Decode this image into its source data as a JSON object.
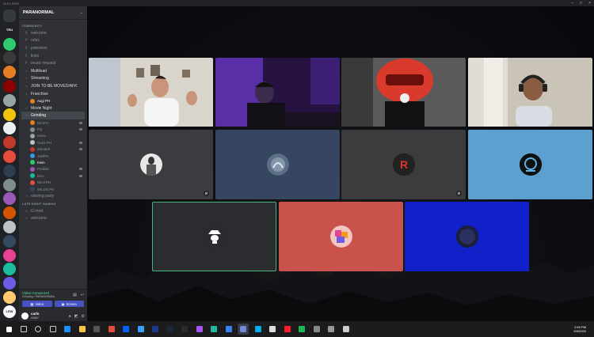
{
  "window": {
    "title": "DISCORD"
  },
  "server": {
    "name": "PARANORMAL"
  },
  "guilds": [
    {
      "label": "",
      "color": "#36393f"
    },
    {
      "label": "TRU",
      "color": "#202225"
    },
    {
      "label": "",
      "color": "#2ecc71"
    },
    {
      "label": "",
      "color": "#3a3a3a"
    },
    {
      "label": "",
      "color": "#e67e22"
    },
    {
      "label": "",
      "color": "#8b0000"
    },
    {
      "label": "",
      "color": "#95a5a6"
    },
    {
      "label": "",
      "color": "#f1c40f"
    },
    {
      "label": "",
      "color": "#ecf0f1"
    },
    {
      "label": "",
      "color": "#c0392b"
    },
    {
      "label": "",
      "color": "#e74c3c"
    },
    {
      "label": "",
      "color": "#2c3e50"
    },
    {
      "label": "",
      "color": "#7f8c8d"
    },
    {
      "label": "",
      "color": "#9b59b6"
    },
    {
      "label": "",
      "color": "#d35400"
    },
    {
      "label": "",
      "color": "#bdc3c7"
    },
    {
      "label": "",
      "color": "#34495e"
    },
    {
      "label": "",
      "color": "#e84393"
    },
    {
      "label": "",
      "color": "#1abc9c"
    },
    {
      "label": "",
      "color": "#6c5ce7"
    },
    {
      "label": "",
      "color": "#fdcb6e"
    },
    {
      "label": "LEW",
      "color": "#f5f6fa"
    }
  ],
  "sidebar": {
    "categories": [
      "COMMUNITY",
      "LATE NIGHT GAMING"
    ],
    "text_channels": [
      "welcome",
      "rules",
      "pokemon",
      "links",
      "music-request"
    ],
    "voice_channels": [
      "Multiload",
      "Streaming",
      "JOIN TO BE MOVED/AFK",
      "Franchise"
    ],
    "franchise_user": "Augi PH",
    "more_channels": [
      "Movie Night"
    ],
    "active_channel": "Grinding",
    "grinding_users": [
      "DevPH",
      "PQ",
      "Ivana",
      "Gumi PH",
      "Soloded",
      "JaelPH",
      "Kwin",
      "Freddie",
      "Ezio",
      "Nicol PH",
      "WILDS PH"
    ],
    "after_channels": [
      "viewing party"
    ],
    "late_night_channels": [
      "G mod",
      "welcome"
    ]
  },
  "voice_panel": {
    "status": "Video Connected",
    "sub": "Grinding / PARANORMAL",
    "video_label": "Video",
    "screen_label": "Screen"
  },
  "user_panel": {
    "name": "carlo",
    "tag": "#9867"
  },
  "clock": {
    "time": "2:59 PM",
    "date": "5/9/2020"
  },
  "tiles": [
    {
      "type": "camera",
      "scene": "bright-room"
    },
    {
      "type": "camera",
      "scene": "purple-room"
    },
    {
      "type": "camera",
      "scene": "red-helmet"
    },
    {
      "type": "camera",
      "scene": "headset-guy"
    },
    {
      "type": "avatar",
      "bg": "#3b3c3f",
      "mark": "figure",
      "muted": true
    },
    {
      "type": "avatar",
      "bg": "#364560",
      "mark": "smoke",
      "muted": false
    },
    {
      "type": "avatar",
      "bg": "#3c3c3e",
      "mark": "r-logo",
      "muted": true
    },
    {
      "type": "avatar",
      "bg": "#5da0d0",
      "mark": "circle-logo",
      "muted": false
    },
    {
      "type": "avatar",
      "bg": "#2b2c2f",
      "mark": "mask",
      "muted": false,
      "speaking": true
    },
    {
      "type": "avatar",
      "bg": "#c9524d",
      "mark": "pixel-art",
      "muted": false
    },
    {
      "type": "avatar",
      "bg": "#1220c9",
      "mark": "dark-circle",
      "muted": false
    }
  ],
  "taskbar_icons": [
    {
      "name": "windows-start-icon",
      "color": "#ffffff"
    },
    {
      "name": "search-icon",
      "color": "#cccccc"
    },
    {
      "name": "cortana-icon",
      "color": "#cccccc"
    },
    {
      "name": "task-view-icon",
      "color": "#cccccc"
    },
    {
      "name": "edge-icon",
      "color": "#1e90ff"
    },
    {
      "name": "folder-icon",
      "color": "#f6c343"
    },
    {
      "name": "store-icon",
      "color": "#555555"
    },
    {
      "name": "app-red-icon",
      "color": "#e74c3c"
    },
    {
      "name": "dropbox-icon",
      "color": "#0061fe"
    },
    {
      "name": "bolt-icon",
      "color": "#3aa0ff"
    },
    {
      "name": "ps-icon",
      "color": "#1a3a8a"
    },
    {
      "name": "steam-icon",
      "color": "#1b2838"
    },
    {
      "name": "hex-icon",
      "color": "#2a2a2a"
    },
    {
      "name": "activity-icon",
      "color": "#a855f7"
    },
    {
      "name": "teal-app-icon",
      "color": "#1abc9c"
    },
    {
      "name": "blue-app-icon",
      "color": "#3b82f6"
    },
    {
      "name": "discord-icon",
      "color": "#7289da"
    },
    {
      "name": "skype-icon",
      "color": "#00aff0"
    },
    {
      "name": "circle-app-icon",
      "color": "#dddddd"
    },
    {
      "name": "opera-icon",
      "color": "#ff1b2d"
    },
    {
      "name": "spotify-icon",
      "color": "#1db954"
    },
    {
      "name": "monitor-icon",
      "color": "#888888"
    },
    {
      "name": "grid-app-icon",
      "color": "#999999"
    },
    {
      "name": "back-icon",
      "color": "#cccccc"
    }
  ]
}
